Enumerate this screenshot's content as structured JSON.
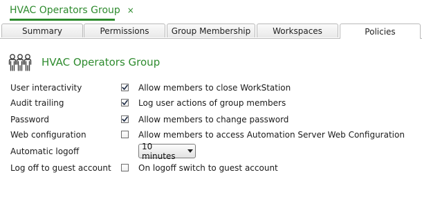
{
  "document_tab": {
    "title": "HVAC Operators Group",
    "close_glyph": "×"
  },
  "tabs": [
    {
      "label": "Summary",
      "active": false
    },
    {
      "label": "Permissions",
      "active": false
    },
    {
      "label": "Group Membership",
      "active": false
    },
    {
      "label": "Workspaces",
      "active": false
    },
    {
      "label": "Policies",
      "active": true
    }
  ],
  "group": {
    "title": "HVAC Operators Group",
    "icon": "user-group-icon"
  },
  "policies": {
    "user_interactivity": {
      "label": "User interactivity",
      "checked": true,
      "text": "Allow members to close WorkStation"
    },
    "audit_trailing": {
      "label": "Audit trailing",
      "checked": true,
      "text": "Log user actions of group members"
    },
    "password": {
      "label": "Password",
      "checked": true,
      "text": "Allow members to change password"
    },
    "web_configuration": {
      "label": "Web configuration",
      "checked": false,
      "text": "Allow members to access Automation Server Web Configuration"
    },
    "automatic_logoff": {
      "label": "Automatic logoff",
      "value": "10 minutes"
    },
    "guest_logoff": {
      "label": "Log off to guest account",
      "checked": false,
      "text": "On logoff switch to guest account"
    }
  },
  "colors": {
    "accent": "#2e8b2e",
    "border": "#b8b8b8",
    "background": "#ffffff"
  }
}
